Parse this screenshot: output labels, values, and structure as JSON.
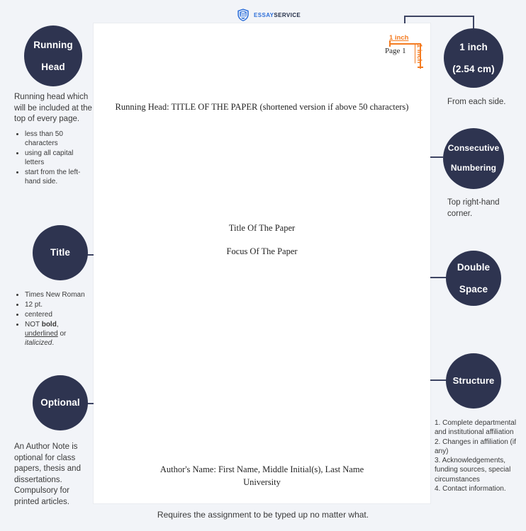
{
  "brand": {
    "name_part1": "ESSAY",
    "name_part2": "SERVICE",
    "icon": "shield-logo-icon",
    "color": "#2e6fd9"
  },
  "theme": {
    "badge_color": "#2e3450",
    "connector_color": "#3d4463",
    "ruler_color": "#f47b20",
    "page_background": "#ffffff",
    "canvas_background": "#f2f4f8"
  },
  "paper": {
    "page_number": "Page 1",
    "running_head": "Running Head: TITLE OF THE PAPER (shortened version if above 50 characters)",
    "title": "Title Of The Paper",
    "focus": "Focus Of The Paper",
    "author": "Author's Name: First Name, Middle Initial(s), Last Name",
    "university": "University",
    "margin_top_label": "1 inch",
    "margin_right_label": "1 inch"
  },
  "badges": {
    "running_head": {
      "line1": "Running",
      "line2": "Head"
    },
    "title": {
      "line1": "Title"
    },
    "optional": {
      "line1": "Optional"
    },
    "one_inch": {
      "line1": "1 inch",
      "line2": "(2.54 cm)"
    },
    "consecutive_numbering": {
      "line1": "Consecutive",
      "line2": "Numbering"
    },
    "double_space": {
      "line1": "Double",
      "line2": "Space"
    },
    "structure": {
      "line1": "Structure"
    }
  },
  "notes": {
    "running_head": {
      "body": "Running head which will be included at the top of every page.",
      "bullets": [
        "less than 50 characters",
        "using all capital letters",
        "start from the left-hand side."
      ]
    },
    "title": {
      "bullets_plain": [
        "Times New Roman",
        "12 pt.",
        "centered"
      ],
      "bullet_rich_prefix": "NOT ",
      "bullet_rich_bold": "bold",
      "bullet_rich_mid": ", ",
      "bullet_rich_underline": "underlined",
      "bullet_rich_or": " or ",
      "bullet_rich_italic": "italicized",
      "bullet_rich_end": "."
    },
    "optional": {
      "body": "An Author Note is optional for class papers, thesis and dissertations. Compulsory for printed articles."
    },
    "one_inch": {
      "body": "From each side."
    },
    "consecutive_numbering": {
      "body": "Top right-hand corner."
    },
    "structure": {
      "items": [
        "1. Complete departmental and institutional affiliation",
        "2. Changes in affiliation (if any)",
        "3. Acknowledgements, funding sources, special circumstances",
        "4. Contact information."
      ]
    }
  },
  "caption": "Requires the assignment to be typed up no matter what."
}
